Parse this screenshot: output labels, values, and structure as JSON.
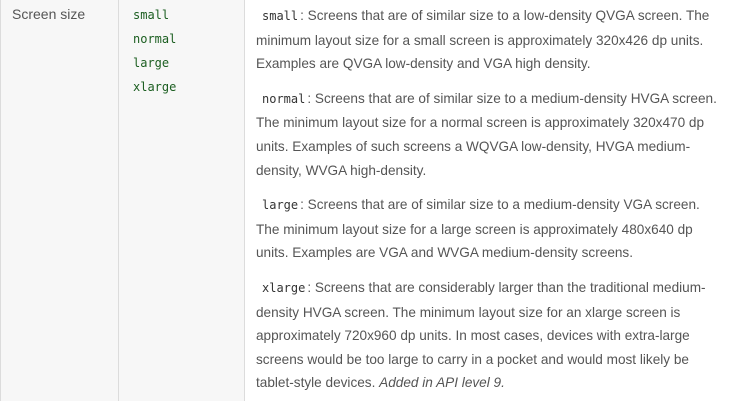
{
  "row": {
    "label": "Screen size",
    "qualifiers": [
      "small",
      "normal",
      "large",
      "xlarge"
    ],
    "descriptions": [
      {
        "code": "small",
        "text": ": Screens that are of similar size to a low-density QVGA screen. The minimum layout size for a small screen is approximately 320x426 dp units. Examples are QVGA low-density and VGA high density."
      },
      {
        "code": "normal",
        "text": ": Screens that are of similar size to a medium-density HVGA screen. The minimum layout size for a normal screen is approximately 320x470 dp units. Examples of such screens a WQVGA low-density, HVGA medium-density, WVGA high-density."
      },
      {
        "code": "large",
        "text": ": Screens that are of similar size to a medium-density VGA screen. The minimum layout size for a large screen is approximately 480x640 dp units. Examples are VGA and WVGA medium-density screens."
      },
      {
        "code": "xlarge",
        "text": ": Screens that are considerably larger than the traditional medium-density HVGA screen. The minimum layout size for an xlarge screen is approximately 720x960 dp units. In most cases, devices with extra-large screens would be too large to carry in a pocket and would most likely be tablet-style devices.",
        "note": "Added in API level 9."
      }
    ]
  }
}
